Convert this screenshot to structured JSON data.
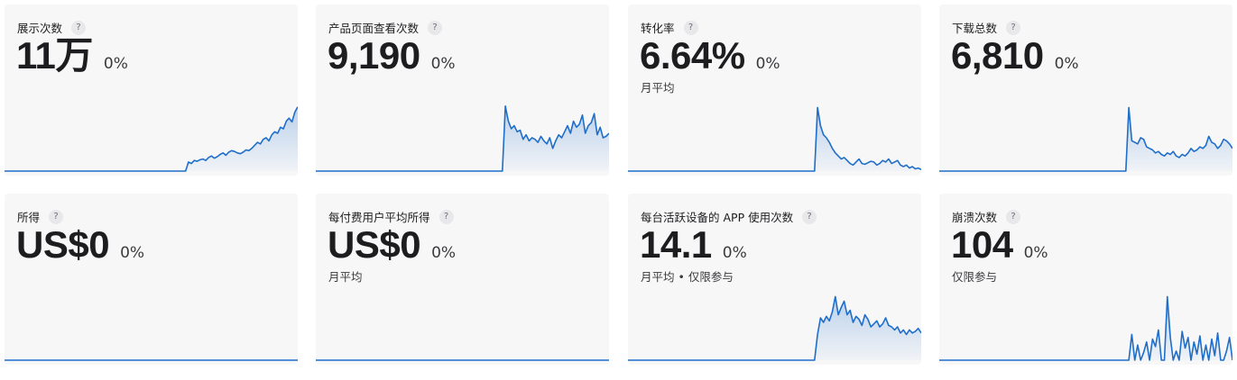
{
  "accent_color": "#1f6ec9",
  "help_icon_glyph": "?",
  "cards": [
    {
      "title": "展示次数",
      "value": "11万",
      "change": "0%",
      "note": "",
      "trend": [
        0,
        0,
        0,
        0,
        0,
        0,
        0,
        0,
        0,
        0,
        0,
        0,
        0,
        0,
        0,
        0,
        0,
        0,
        0,
        0,
        0,
        0,
        0,
        0,
        0,
        0,
        0,
        0,
        0,
        0,
        0,
        0,
        0,
        0,
        0,
        0,
        0,
        0,
        0,
        0,
        0,
        0,
        0,
        0,
        0,
        0,
        0,
        0,
        0,
        0,
        0,
        0,
        0,
        0,
        0,
        0,
        0,
        0,
        0,
        0,
        0,
        0,
        0,
        0,
        12,
        10,
        14,
        13,
        15,
        16,
        14,
        18,
        20,
        17,
        19,
        22,
        24,
        21,
        25,
        27,
        26,
        24,
        23,
        25,
        28,
        27,
        30,
        34,
        38,
        36,
        42,
        44,
        40,
        48,
        52,
        50,
        58,
        56,
        66,
        70,
        65,
        78,
        85
      ]
    },
    {
      "title": "产品页面查看次数",
      "value": "9,190",
      "change": "0%",
      "note": "",
      "trend": [
        0,
        0,
        0,
        0,
        0,
        0,
        0,
        0,
        0,
        0,
        0,
        0,
        0,
        0,
        0,
        0,
        0,
        0,
        0,
        0,
        0,
        0,
        0,
        0,
        0,
        0,
        0,
        0,
        0,
        0,
        0,
        0,
        0,
        0,
        0,
        0,
        0,
        0,
        0,
        0,
        0,
        0,
        0,
        0,
        0,
        0,
        0,
        0,
        0,
        0,
        0,
        0,
        0,
        0,
        0,
        0,
        0,
        0,
        0,
        0,
        0,
        0,
        0,
        0,
        86,
        66,
        56,
        60,
        52,
        54,
        42,
        48,
        40,
        44,
        42,
        38,
        46,
        40,
        36,
        44,
        30,
        40,
        48,
        44,
        52,
        60,
        50,
        66,
        58,
        62,
        74,
        50,
        60,
        64,
        76,
        48,
        58,
        44,
        46,
        50
      ]
    },
    {
      "title": "转化率",
      "value": "6.64%",
      "change": "0%",
      "note": "月平均",
      "trend": [
        0,
        0,
        0,
        0,
        0,
        0,
        0,
        0,
        0,
        0,
        0,
        0,
        0,
        0,
        0,
        0,
        0,
        0,
        0,
        0,
        0,
        0,
        0,
        0,
        0,
        0,
        0,
        0,
        0,
        0,
        0,
        0,
        0,
        0,
        0,
        0,
        0,
        0,
        0,
        0,
        0,
        0,
        0,
        0,
        0,
        0,
        0,
        0,
        0,
        0,
        0,
        0,
        0,
        0,
        0,
        0,
        0,
        0,
        0,
        0,
        0,
        0,
        0,
        0,
        84,
        60,
        48,
        44,
        38,
        30,
        24,
        20,
        16,
        18,
        14,
        10,
        8,
        12,
        16,
        10,
        9,
        11,
        13,
        12,
        8,
        10,
        14,
        12,
        16,
        10,
        12,
        14,
        8,
        6,
        8,
        4,
        6,
        3,
        4,
        2
      ]
    },
    {
      "title": "下载总数",
      "value": "6,810",
      "change": "0%",
      "note": "",
      "trend": [
        0,
        0,
        0,
        0,
        0,
        0,
        0,
        0,
        0,
        0,
        0,
        0,
        0,
        0,
        0,
        0,
        0,
        0,
        0,
        0,
        0,
        0,
        0,
        0,
        0,
        0,
        0,
        0,
        0,
        0,
        0,
        0,
        0,
        0,
        0,
        0,
        0,
        0,
        0,
        0,
        0,
        0,
        0,
        0,
        0,
        0,
        0,
        0,
        0,
        0,
        0,
        0,
        0,
        0,
        0,
        0,
        0,
        0,
        0,
        0,
        0,
        0,
        0,
        0,
        84,
        40,
        38,
        36,
        44,
        42,
        32,
        30,
        28,
        24,
        26,
        22,
        20,
        24,
        22,
        26,
        20,
        18,
        22,
        20,
        24,
        30,
        26,
        28,
        32,
        30,
        34,
        46,
        38,
        36,
        30,
        34,
        42,
        40,
        36,
        30
      ]
    },
    {
      "title": "所得",
      "value": "US$0",
      "change": "0%",
      "note": "",
      "trend": [
        0,
        0,
        0,
        0,
        0,
        0,
        0,
        0,
        0,
        0
      ]
    },
    {
      "title": "每付费用户平均所得",
      "value": "US$0",
      "change": "0%",
      "note": "月平均",
      "trend": [
        0,
        0,
        0,
        0,
        0,
        0,
        0,
        0,
        0,
        0
      ]
    },
    {
      "title": "每台活跃设备的 APP 使用次数",
      "value": "14.1",
      "change": "0%",
      "note": "月平均 • 仅限参与",
      "trend": [
        0,
        0,
        0,
        0,
        0,
        0,
        0,
        0,
        0,
        0,
        0,
        0,
        0,
        0,
        0,
        0,
        0,
        0,
        0,
        0,
        0,
        0,
        0,
        0,
        0,
        0,
        0,
        0,
        0,
        0,
        0,
        0,
        0,
        0,
        0,
        0,
        0,
        0,
        0,
        0,
        0,
        0,
        0,
        0,
        0,
        0,
        0,
        0,
        0,
        0,
        0,
        0,
        0,
        0,
        0,
        0,
        0,
        0,
        0,
        0,
        0,
        0,
        0,
        0,
        34,
        56,
        50,
        58,
        52,
        64,
        84,
        60,
        70,
        78,
        60,
        66,
        50,
        58,
        54,
        46,
        60,
        54,
        44,
        48,
        52,
        44,
        48,
        56,
        46,
        44,
        40,
        44,
        36,
        40,
        34,
        40,
        36,
        38,
        42,
        36
      ]
    },
    {
      "title": "崩溃次数",
      "value": "104",
      "change": "0%",
      "note": "仅限参与",
      "trend": [
        0,
        0,
        0,
        0,
        0,
        0,
        0,
        0,
        0,
        0,
        0,
        0,
        0,
        0,
        0,
        0,
        0,
        0,
        0,
        0,
        0,
        0,
        0,
        0,
        0,
        0,
        0,
        0,
        0,
        0,
        0,
        0,
        0,
        0,
        0,
        0,
        0,
        0,
        0,
        0,
        0,
        0,
        0,
        0,
        0,
        0,
        0,
        0,
        0,
        0,
        0,
        0,
        0,
        0,
        0,
        0,
        0,
        0,
        0,
        0,
        0,
        0,
        0,
        0,
        0,
        34,
        0,
        20,
        0,
        10,
        24,
        0,
        28,
        18,
        40,
        0,
        0,
        84,
        30,
        0,
        12,
        0,
        38,
        16,
        30,
        0,
        24,
        8,
        32,
        0,
        20,
        0,
        28,
        6,
        36,
        0,
        0,
        12,
        30,
        0
      ]
    }
  ]
}
